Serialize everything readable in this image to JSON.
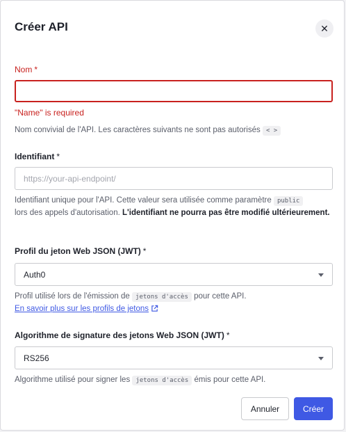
{
  "dialog": {
    "title": "Créer API",
    "close_icon": "close-icon"
  },
  "name_field": {
    "label": "Nom",
    "required_mark": "*",
    "value": "",
    "error": "\"Name\" is required",
    "help_text": "Nom convivial de l'API. Les caractères suivants ne sont pas autorisés",
    "help_code": "< >"
  },
  "identifier_field": {
    "label": "Identifiant",
    "required_mark": "*",
    "placeholder": "https://your-api-endpoint/",
    "help_text_1": "Identifiant unique pour l'API. Cette valeur sera utilisée comme paramètre",
    "help_code": "public",
    "help_text_2": "lors des appels d'autorisation.",
    "help_bold": "L'identifiant ne pourra pas être modifié ultérieurement."
  },
  "jwt_profile_field": {
    "label": "Profil du jeton Web JSON (JWT)",
    "required_mark": "*",
    "selected": "Auth0",
    "help_text_1": "Profil utilisé lors de l'émission de",
    "help_code": "jetons d'accès",
    "help_text_2": "pour cette API.",
    "link_text": "En savoir plus sur les profils de jetons"
  },
  "signing_alg_field": {
    "label": "Algorithme de signature des jetons Web JSON (JWT)",
    "required_mark": "*",
    "selected": "RS256",
    "help_text_1": "Algorithme utilisé pour signer les",
    "help_code": "jetons d'accès",
    "help_text_2": "émis pour cette API."
  },
  "buttons": {
    "cancel": "Annuler",
    "create": "Créer"
  },
  "colors": {
    "primary": "#3f59e4",
    "error": "#c8211e"
  }
}
